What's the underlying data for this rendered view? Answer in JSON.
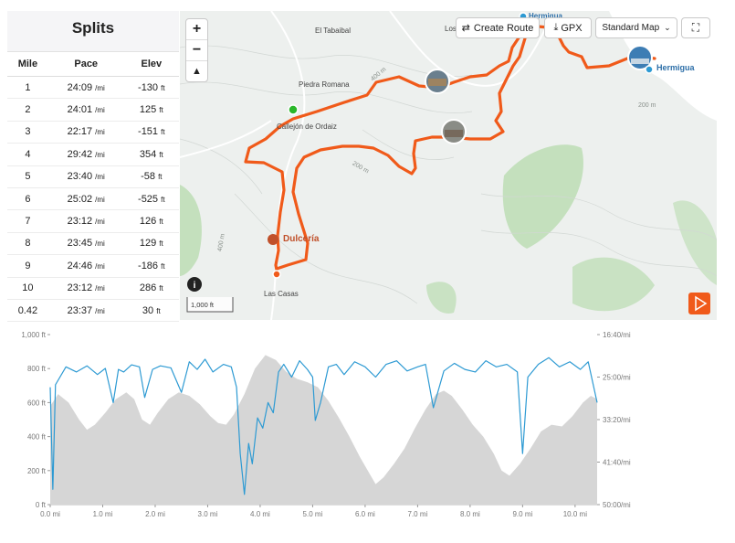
{
  "splits": {
    "title": "Splits",
    "columns": [
      "Mile",
      "Pace",
      "Elev"
    ],
    "pace_unit": "/mi",
    "elev_unit": "ft",
    "rows": [
      {
        "mile": "1",
        "pace": "24:09",
        "elev": "-130"
      },
      {
        "mile": "2",
        "pace": "24:01",
        "elev": "125"
      },
      {
        "mile": "3",
        "pace": "22:17",
        "elev": "-151"
      },
      {
        "mile": "4",
        "pace": "29:42",
        "elev": "354"
      },
      {
        "mile": "5",
        "pace": "23:40",
        "elev": "-58"
      },
      {
        "mile": "6",
        "pace": "25:02",
        "elev": "-525"
      },
      {
        "mile": "7",
        "pace": "23:12",
        "elev": "126"
      },
      {
        "mile": "8",
        "pace": "23:45",
        "elev": "129"
      },
      {
        "mile": "9",
        "pace": "24:46",
        "elev": "-186"
      },
      {
        "mile": "10",
        "pace": "23:12",
        "elev": "286"
      },
      {
        "mile": "0.42",
        "pace": "23:37",
        "elev": "30"
      }
    ]
  },
  "map": {
    "buttons": {
      "create_route": "Create Route",
      "gpx": "GPX",
      "map_type": "Standard Map"
    },
    "zoom": {
      "in": "+",
      "out": "−",
      "compass": "▲"
    },
    "labels": {
      "el_tabaibal": "El Tabaibal",
      "los": "Los",
      "hermigua_top": "Hermigua",
      "hermigua": "Hermigua",
      "piedra_romana": "Piedra Romana",
      "callejon": "Callejón de Ordaiz",
      "dulceria": "Dulcería",
      "las_casas": "Las Casas",
      "c400": "400 m",
      "c200a": "200 m",
      "c200b": "200 m",
      "c400b": "400 m"
    },
    "scale": "1,000 ft",
    "info_icon": "i",
    "route_color": "#f05a1a",
    "start_color": "#2ab72a"
  },
  "chart_data": {
    "type": "area",
    "x_unit": "mi",
    "xlim": [
      0,
      10.42
    ],
    "x_ticks": [
      "0.0 mi",
      "1.0 mi",
      "2.0 mi",
      "3.0 mi",
      "4.0 mi",
      "5.0 mi",
      "6.0 mi",
      "7.0 mi",
      "8.0 mi",
      "9.0 mi",
      "10.0 mi"
    ],
    "y_left_ticks": [
      "0 ft",
      "200 ft",
      "400 ft",
      "600 ft",
      "800 ft",
      "1,000 ft"
    ],
    "y_left_lim": [
      0,
      1000
    ],
    "y_right_ticks": [
      "16:40/mi",
      "25:00/mi",
      "33:20/mi",
      "41:40/mi",
      "50:00/mi"
    ],
    "series": [
      {
        "kind": "elevation",
        "color": "#d6d6d6",
        "x": [
          0,
          0.15,
          0.35,
          0.55,
          0.7,
          0.85,
          1.05,
          1.25,
          1.45,
          1.6,
          1.75,
          1.9,
          2.05,
          2.25,
          2.45,
          2.65,
          2.85,
          3.05,
          3.2,
          3.35,
          3.5,
          3.7,
          3.9,
          4.1,
          4.3,
          4.5,
          4.7,
          4.9,
          5.1,
          5.3,
          5.5,
          5.7,
          5.9,
          6.05,
          6.2,
          6.35,
          6.55,
          6.75,
          6.95,
          7.15,
          7.35,
          7.5,
          7.65,
          7.85,
          8.05,
          8.25,
          8.45,
          8.6,
          8.75,
          8.95,
          9.15,
          9.35,
          9.55,
          9.75,
          9.95,
          10.15,
          10.3,
          10.42
        ],
        "y": [
          580,
          650,
          600,
          500,
          440,
          470,
          540,
          620,
          660,
          620,
          500,
          470,
          540,
          620,
          660,
          640,
          590,
          520,
          480,
          470,
          530,
          650,
          800,
          880,
          850,
          780,
          740,
          720,
          690,
          610,
          510,
          400,
          280,
          200,
          120,
          160,
          240,
          330,
          450,
          560,
          650,
          670,
          640,
          560,
          470,
          400,
          300,
          200,
          170,
          240,
          330,
          430,
          470,
          460,
          520,
          600,
          640,
          620
        ]
      },
      {
        "kind": "pace",
        "color": "#2d9ad3",
        "x": [
          0,
          0.05,
          0.1,
          0.3,
          0.5,
          0.7,
          0.9,
          1.05,
          1.2,
          1.3,
          1.4,
          1.55,
          1.7,
          1.8,
          1.95,
          2.1,
          2.3,
          2.5,
          2.65,
          2.8,
          2.95,
          3.1,
          3.3,
          3.45,
          3.55,
          3.62,
          3.7,
          3.78,
          3.85,
          3.95,
          4.05,
          4.15,
          4.25,
          4.35,
          4.45,
          4.6,
          4.75,
          4.9,
          5.0,
          5.05,
          5.15,
          5.3,
          5.45,
          5.6,
          5.8,
          6.0,
          6.2,
          6.4,
          6.6,
          6.8,
          7.0,
          7.15,
          7.3,
          7.5,
          7.7,
          7.9,
          8.1,
          8.3,
          8.5,
          8.7,
          8.9,
          9.0,
          9.1,
          9.3,
          9.5,
          9.7,
          9.9,
          10.1,
          10.25,
          10.42
        ],
        "y": [
          27.0,
          47.0,
          26.5,
          23.0,
          24.0,
          22.8,
          24.5,
          23.3,
          30.0,
          23.5,
          24.0,
          22.6,
          23.0,
          29.0,
          23.5,
          22.8,
          23.2,
          28.0,
          22.0,
          23.5,
          21.5,
          24.0,
          22.5,
          23.0,
          27.0,
          40.0,
          48.0,
          38.0,
          42.0,
          33.0,
          35.0,
          30.0,
          32.0,
          24.0,
          22.5,
          25.0,
          21.8,
          23.5,
          25.0,
          33.5,
          30.0,
          23.0,
          22.5,
          24.5,
          22.0,
          23.0,
          25.0,
          22.5,
          21.8,
          23.8,
          23.0,
          22.5,
          31.0,
          23.8,
          22.3,
          23.5,
          24.0,
          21.8,
          23.0,
          22.5,
          24.0,
          40.0,
          25.0,
          22.5,
          21.2,
          23.0,
          22.0,
          23.5,
          22.0,
          30.0
        ]
      }
    ],
    "pace_lim_minutes": [
      16.667,
      50.0
    ]
  }
}
